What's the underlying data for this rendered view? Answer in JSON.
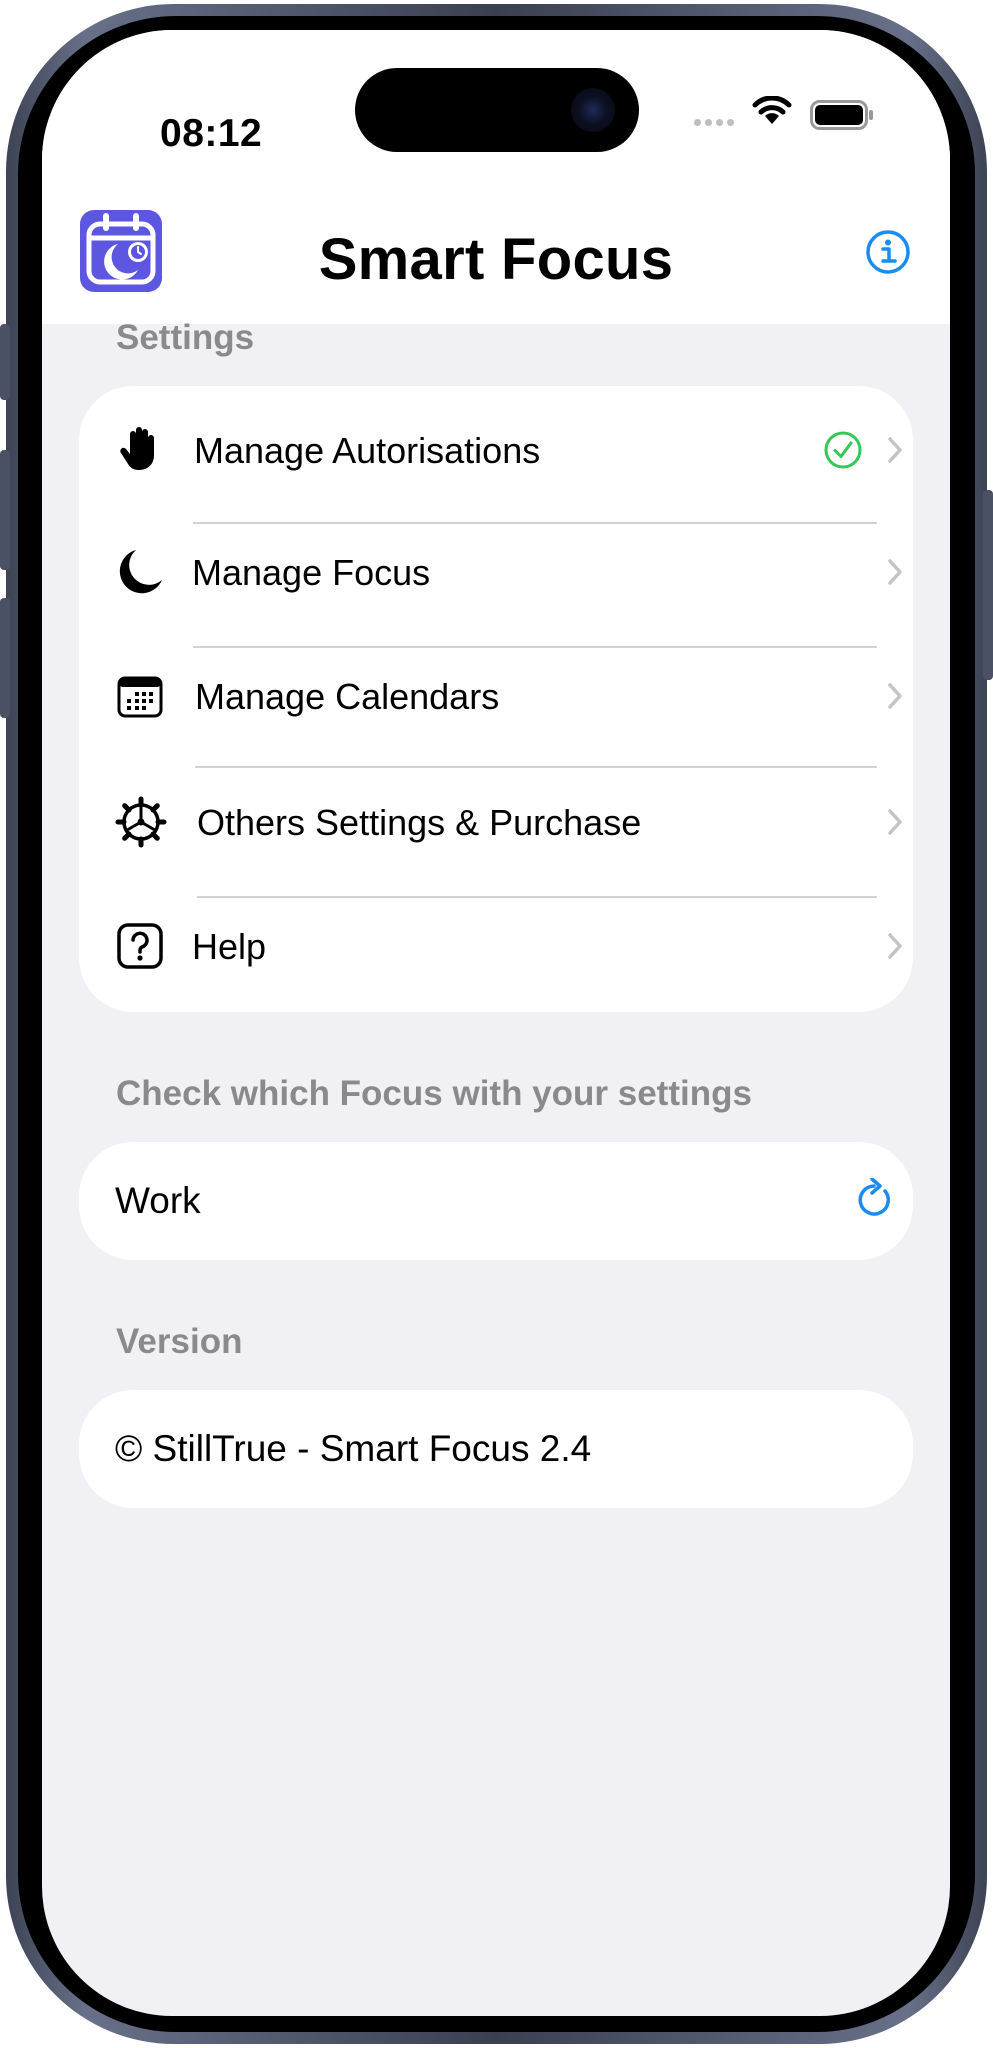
{
  "status_bar": {
    "time": "08:12"
  },
  "nav": {
    "title": "Smart Focus",
    "app_icon": "calendar-moon-icon",
    "info_icon": "info-circle-icon"
  },
  "settings": {
    "header": "Settings",
    "items": [
      {
        "label": "Manage Autorisations",
        "icon": "hand-raised-icon",
        "status": "checkmark-circle-icon"
      },
      {
        "label": "Manage Focus",
        "icon": "moon-icon"
      },
      {
        "label": "Manage Calendars",
        "icon": "calendar-icon"
      },
      {
        "label": "Others Settings & Purchase",
        "icon": "gear-icon"
      },
      {
        "label": "Help",
        "icon": "question-square-icon"
      }
    ]
  },
  "focus_check": {
    "header": "Check which Focus with your settings",
    "value": "Work",
    "action_icon": "refresh-icon"
  },
  "version": {
    "header": "Version",
    "value": "© StillTrue - Smart Focus 2.4"
  },
  "colors": {
    "accent": "#1a8cf0",
    "success": "#34c759",
    "app_icon": "#5d56e0",
    "background": "#f0f0f5",
    "section_header": "#8a8a8e",
    "chevron": "#c4c4c7"
  }
}
